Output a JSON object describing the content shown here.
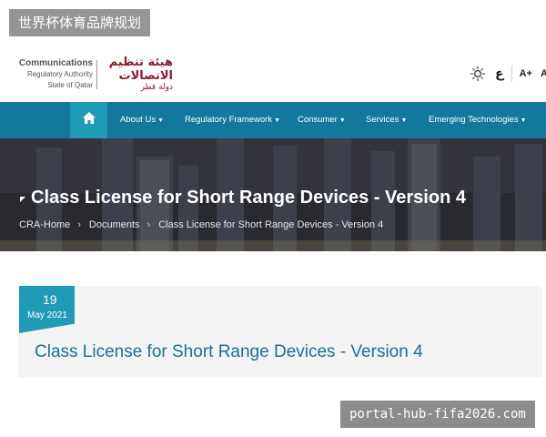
{
  "overlay": {
    "tag": "世界杯体育品牌规划"
  },
  "header": {
    "logo_en": {
      "line1": "Communications",
      "line2": "Regulatory Authority",
      "line3": "State of Qatar"
    },
    "logo_ar": {
      "line1": "هيئة تنظيم",
      "line2": "الاتصالات",
      "line3": "دولة قطر"
    },
    "tools": {
      "brightness_icon": "brightness-icon",
      "lang_label": "ع",
      "font_increase_label": "A+",
      "font_label": "A"
    }
  },
  "nav": {
    "home_icon": "home-icon",
    "items": [
      {
        "label": "About Us"
      },
      {
        "label": "Regulatory Framework"
      },
      {
        "label": "Consumer"
      },
      {
        "label": "Services"
      },
      {
        "label": "Emerging Technologies"
      }
    ]
  },
  "hero": {
    "title": "Class License for Short Range Devices - Version 4",
    "breadcrumb": [
      {
        "label": "CRA-Home"
      },
      {
        "label": "Documents"
      },
      {
        "label": "Class License for Short Range Devices - Version 4"
      }
    ]
  },
  "article": {
    "date_day": "19",
    "date_month_year": "May 2021",
    "title": "Class License for Short Range Devices - Version 4"
  },
  "watermark": {
    "text": "portal-hub-fifa2026.com"
  },
  "colors": {
    "nav_bg": "#14789d",
    "accent": "#1f9bb5",
    "title_blue": "#1f6f90",
    "logo_red": "#8b1b2e"
  }
}
